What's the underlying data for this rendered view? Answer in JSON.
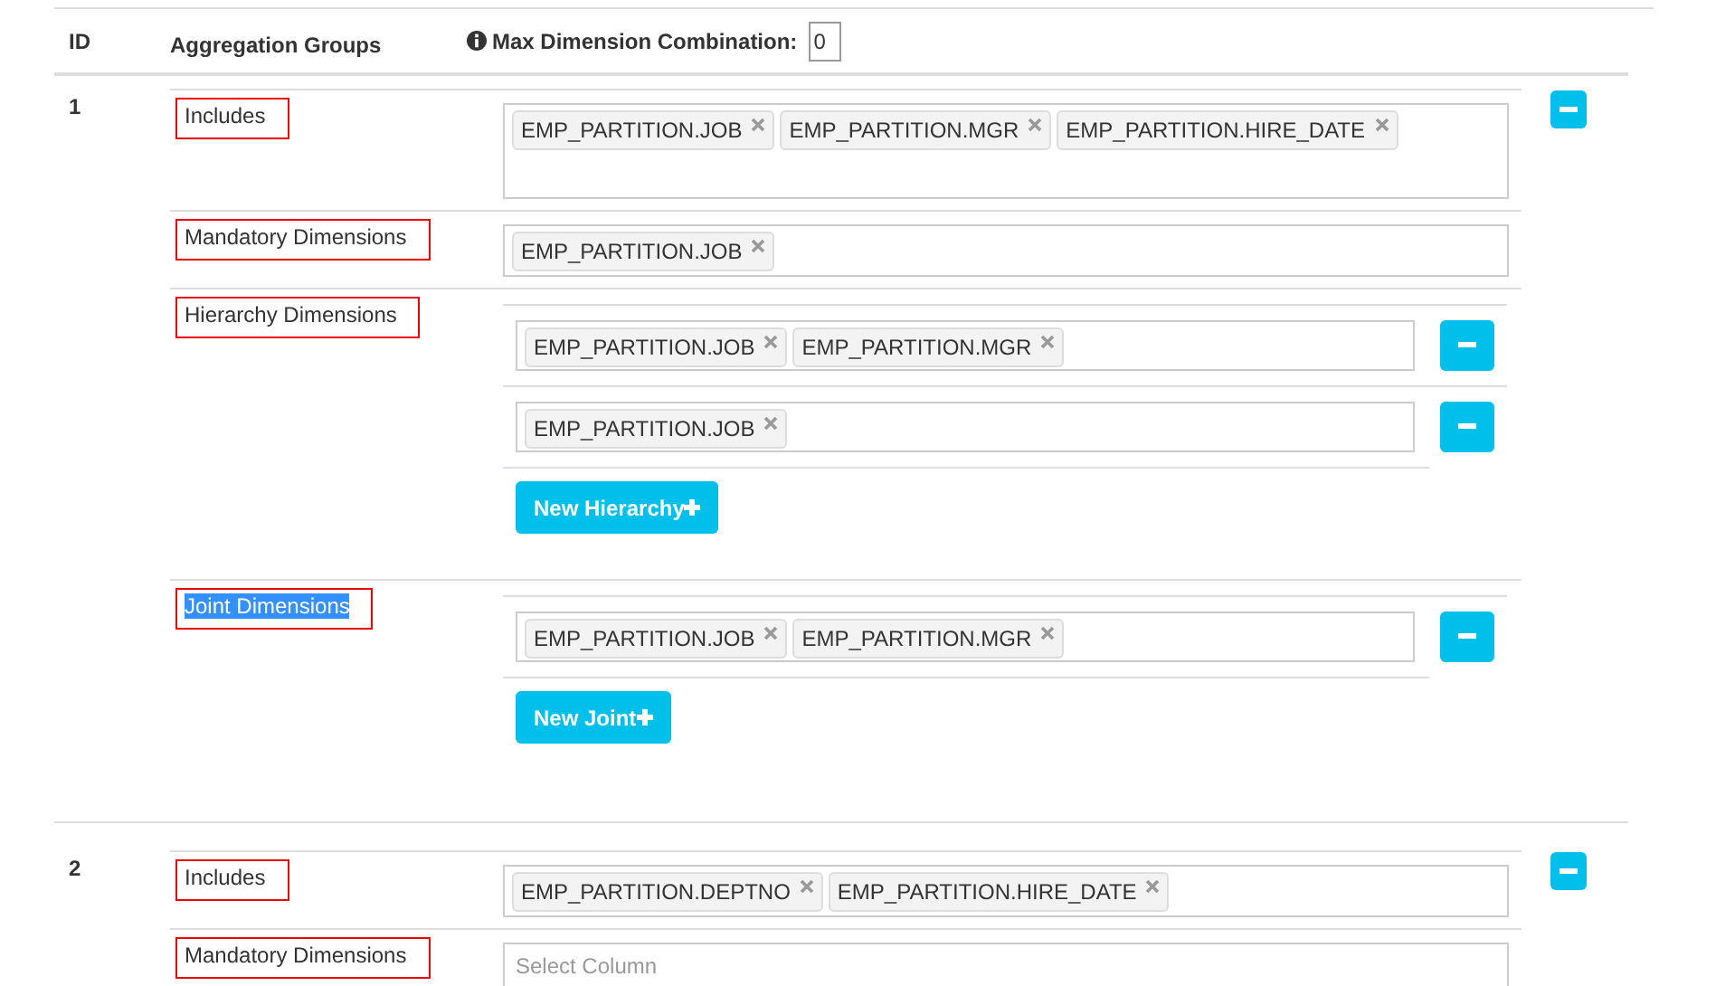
{
  "header": {
    "id_label": "ID",
    "groups_label": "Aggregation Groups",
    "max_label": "Max Dimension Combination:",
    "max_value": "0"
  },
  "groups": [
    {
      "id": "1",
      "sections": [
        {
          "kind": "tags_large",
          "label": "Includes",
          "highlighted": false,
          "tags": [
            "EMP_PARTITION.JOB",
            "EMP_PARTITION.MGR",
            "EMP_PARTITION.HIRE_DATE"
          ]
        },
        {
          "kind": "tags",
          "label": "Mandatory Dimensions",
          "highlighted": false,
          "tags": [
            "EMP_PARTITION.JOB"
          ]
        },
        {
          "kind": "list",
          "label": "Hierarchy Dimensions",
          "highlighted": false,
          "rows": [
            {
              "tags": [
                "EMP_PARTITION.JOB",
                "EMP_PARTITION.MGR"
              ]
            },
            {
              "tags": [
                "EMP_PARTITION.JOB"
              ]
            }
          ],
          "add_button": "New Hierarchy"
        },
        {
          "kind": "list",
          "label": "Joint Dimensions",
          "highlighted": true,
          "rows": [
            {
              "tags": [
                "EMP_PARTITION.JOB",
                "EMP_PARTITION.MGR"
              ]
            }
          ],
          "add_button": "New Joint"
        }
      ]
    },
    {
      "id": "2",
      "sections": [
        {
          "kind": "tags",
          "label": "Includes",
          "highlighted": false,
          "tags": [
            "EMP_PARTITION.DEPTNO",
            "EMP_PARTITION.HIRE_DATE"
          ]
        },
        {
          "kind": "tags",
          "label": "Mandatory Dimensions",
          "highlighted": false,
          "placeholder": "Select Column"
        }
      ]
    }
  ]
}
